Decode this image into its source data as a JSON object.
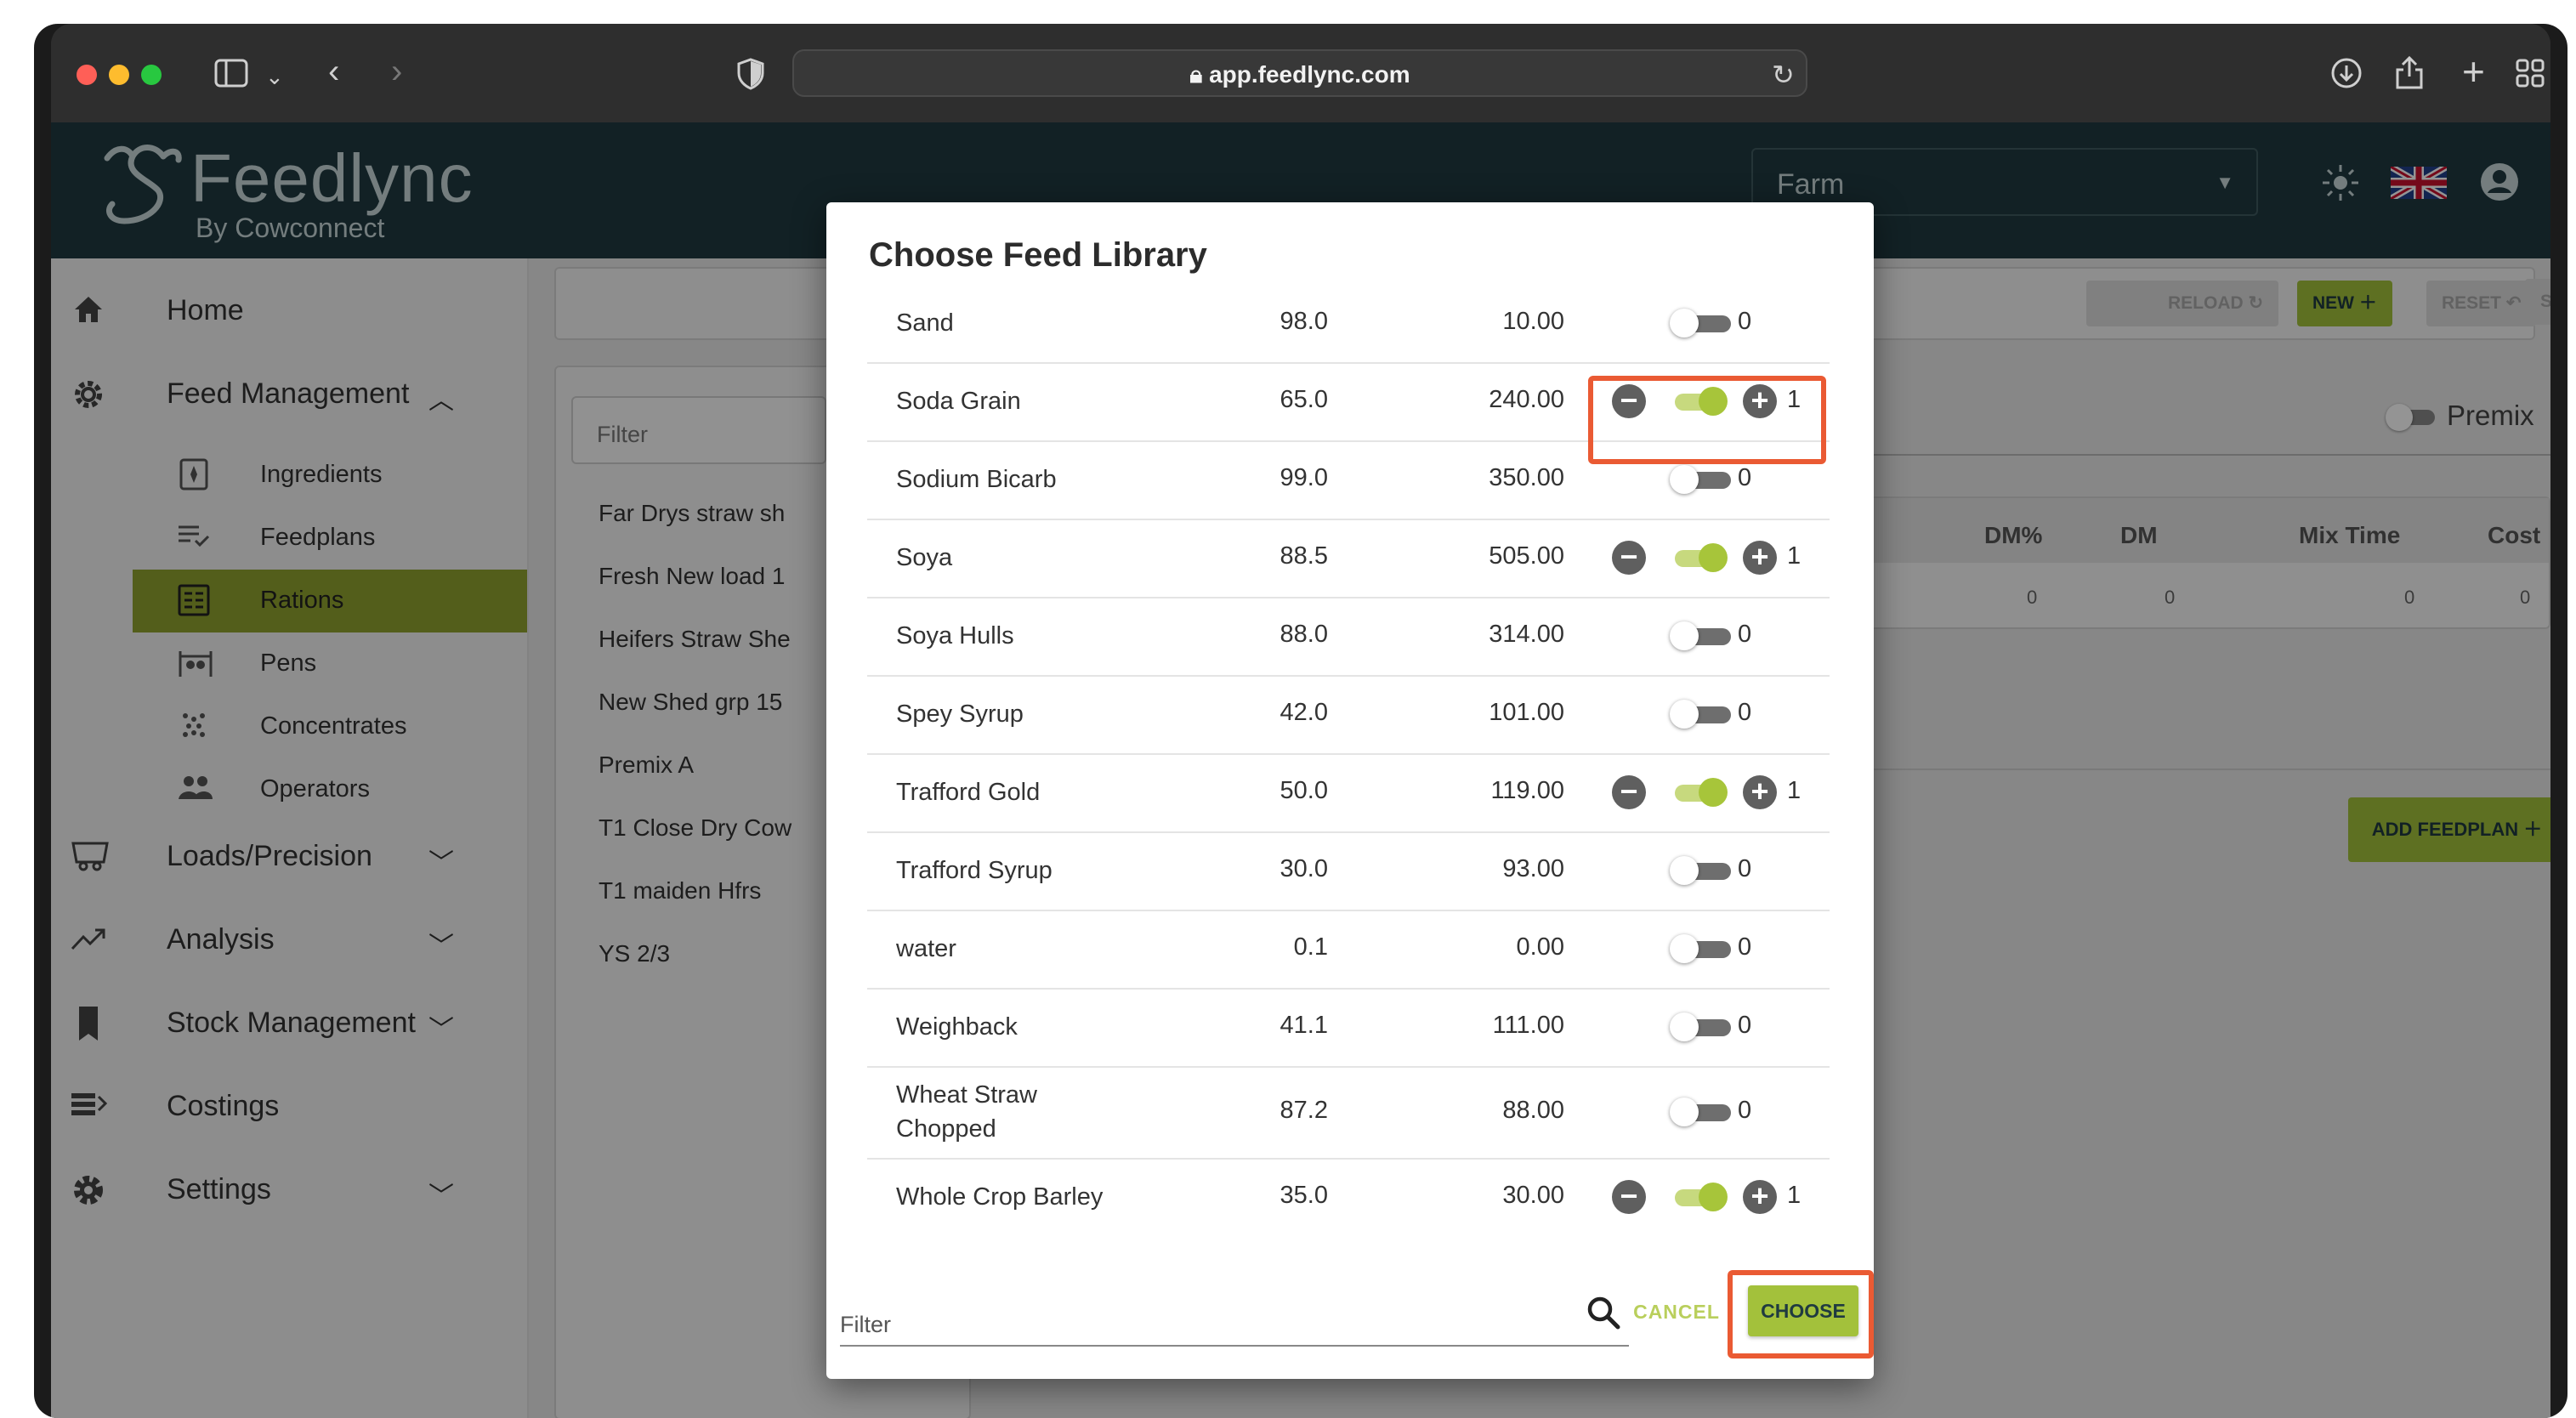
{
  "browser": {
    "url": "app.feedlync.com"
  },
  "app": {
    "logo_title": "Feedlync",
    "logo_subtitle": "By Cowconnect",
    "farm_select_value": "Farm"
  },
  "sidebar": {
    "items": [
      {
        "label": "Home",
        "icon": "home-icon"
      },
      {
        "label": "Feed Management",
        "icon": "gear-icon",
        "expanded": true
      },
      {
        "label": "Loads/Precision",
        "icon": "mixer-wagon-icon"
      },
      {
        "label": "Analysis",
        "icon": "trend-icon"
      },
      {
        "label": "Stock Management",
        "icon": "bookmark-icon"
      },
      {
        "label": "Costings",
        "icon": "costings-icon"
      },
      {
        "label": "Settings",
        "icon": "settings-gear-icon"
      }
    ],
    "subitems": [
      {
        "label": "Ingredients"
      },
      {
        "label": "Feedplans"
      },
      {
        "label": "Rations",
        "active": true
      },
      {
        "label": "Pens"
      },
      {
        "label": "Concentrates"
      },
      {
        "label": "Operators"
      }
    ]
  },
  "toolbar_buttons": {
    "reload": "RELOAD",
    "new": "NEW",
    "reset": "RESET",
    "save": "SAVE"
  },
  "rations_list": {
    "filter_placeholder": "Filter",
    "items": [
      "Far Drys straw sh",
      "Fresh New load 1",
      "Heifers Straw She",
      "New Shed grp 15",
      "Premix A",
      "T1 Close Dry Cow",
      "T1 maiden Hfrs",
      "YS 2/3"
    ]
  },
  "detail": {
    "premix_label": "Premix",
    "columns": [
      "DM%",
      "DM",
      "Mix Time",
      "Cost"
    ],
    "values": [
      "0",
      "0",
      "0",
      "0"
    ],
    "add_feedplan": "ADD FEEDPLAN"
  },
  "modal": {
    "title": "Choose Feed Library",
    "rows": [
      {
        "name": "Sand",
        "dm": "98.0",
        "cost": "10.00",
        "on": false,
        "count": "0"
      },
      {
        "name": "Soda Grain",
        "dm": "65.0",
        "cost": "240.00",
        "on": true,
        "count": "1"
      },
      {
        "name": "Sodium Bicarb",
        "dm": "99.0",
        "cost": "350.00",
        "on": false,
        "count": "0"
      },
      {
        "name": "Soya",
        "dm": "88.5",
        "cost": "505.00",
        "on": true,
        "count": "1"
      },
      {
        "name": "Soya Hulls",
        "dm": "88.0",
        "cost": "314.00",
        "on": false,
        "count": "0"
      },
      {
        "name": "Spey Syrup",
        "dm": "42.0",
        "cost": "101.00",
        "on": false,
        "count": "0"
      },
      {
        "name": "Trafford Gold",
        "dm": "50.0",
        "cost": "119.00",
        "on": true,
        "count": "1"
      },
      {
        "name": "Trafford Syrup",
        "dm": "30.0",
        "cost": "93.00",
        "on": false,
        "count": "0"
      },
      {
        "name": "water",
        "dm": "0.1",
        "cost": "0.00",
        "on": false,
        "count": "0"
      },
      {
        "name": "Weighback",
        "dm": "41.1",
        "cost": "111.00",
        "on": false,
        "count": "0"
      },
      {
        "name": "Wheat Straw Chopped",
        "dm": "87.2",
        "cost": "88.00",
        "on": false,
        "count": "0"
      },
      {
        "name": "Whole Crop Barley",
        "dm": "35.0",
        "cost": "30.00",
        "on": true,
        "count": "1"
      }
    ],
    "filter_placeholder": "Filter",
    "cancel_label": "CANCEL",
    "choose_label": "CHOOSE"
  },
  "colors": {
    "brand_green": "#a3c13b",
    "header_teal": "#1f3a40",
    "highlight": "#ea5a33"
  }
}
